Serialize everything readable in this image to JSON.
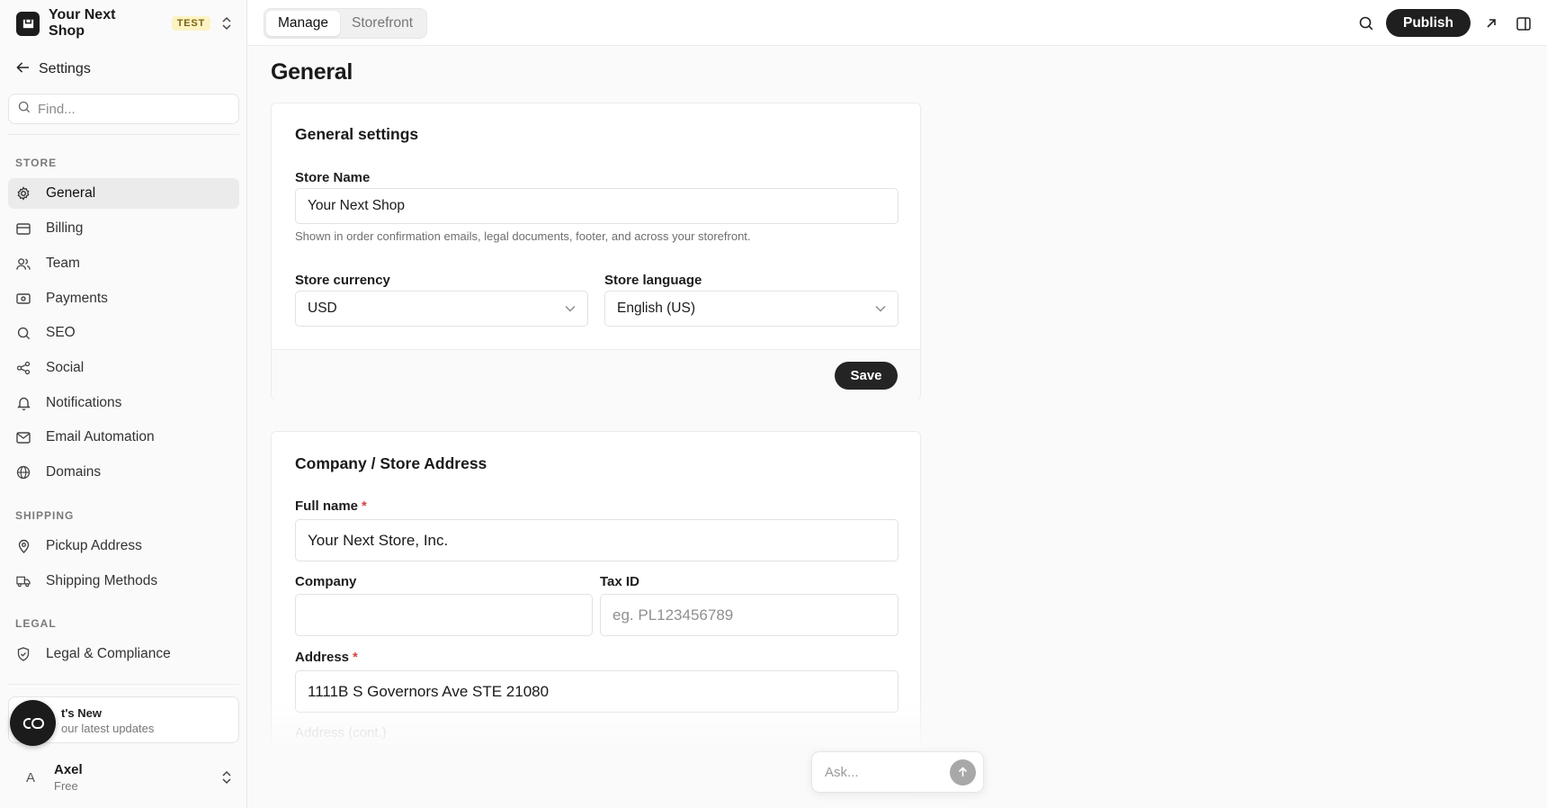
{
  "brand": {
    "name": "Your Next Shop",
    "badge": "TEST"
  },
  "sidebar": {
    "back_label": "Settings",
    "find_placeholder": "Find...",
    "sections": {
      "store": "STORE",
      "shipping": "SHIPPING",
      "legal": "LEGAL"
    },
    "store_items": [
      {
        "label": "General",
        "icon": "gear-icon",
        "active": true
      },
      {
        "label": "Billing",
        "icon": "card-icon"
      },
      {
        "label": "Team",
        "icon": "users-icon"
      },
      {
        "label": "Payments",
        "icon": "money-icon"
      },
      {
        "label": "SEO",
        "icon": "search-icon"
      },
      {
        "label": "Social",
        "icon": "share-icon"
      },
      {
        "label": "Notifications",
        "icon": "bell-icon"
      },
      {
        "label": "Email Automation",
        "icon": "mail-icon"
      },
      {
        "label": "Domains",
        "icon": "globe-icon"
      }
    ],
    "shipping_items": [
      {
        "label": "Pickup Address",
        "icon": "map-pin-icon"
      },
      {
        "label": "Shipping Methods",
        "icon": "truck-icon"
      }
    ],
    "legal_items": [
      {
        "label": "Legal & Compliance",
        "icon": "shield-check-icon"
      }
    ],
    "whats_new": {
      "title": "t's New",
      "subtitle": "our latest updates"
    },
    "user": {
      "initial": "A",
      "name": "Axel",
      "plan": "Free"
    }
  },
  "topbar": {
    "tabs": [
      {
        "label": "Manage",
        "active": true
      },
      {
        "label": "Storefront",
        "active": false
      }
    ],
    "publish_label": "Publish"
  },
  "page": {
    "title": "General"
  },
  "general_settings": {
    "title": "General settings",
    "store_name_label": "Store Name",
    "store_name_value": "Your Next Shop",
    "store_name_help": "Shown in order confirmation emails, legal documents, footer, and across your storefront.",
    "currency_label": "Store currency",
    "currency_value": "USD",
    "language_label": "Store language",
    "language_value": "English (US)",
    "save_label": "Save"
  },
  "address": {
    "title": "Company / Store Address",
    "full_name_label": "Full name",
    "full_name_value": "Your Next Store, Inc.",
    "company_label": "Company",
    "company_value": "",
    "tax_id_label": "Tax ID",
    "tax_id_placeholder": "eg. PL123456789",
    "address_label": "Address",
    "address_value": "1111B S Governors Ave STE 21080",
    "address_cont_label": "Address (cont.)",
    "required_mark": "*"
  },
  "ask": {
    "placeholder": "Ask..."
  },
  "colors": {
    "accent": "#1f1f1f",
    "badge_bg": "#fcf3c4",
    "active_nav": "#ebebeb",
    "required": "#d64545"
  }
}
